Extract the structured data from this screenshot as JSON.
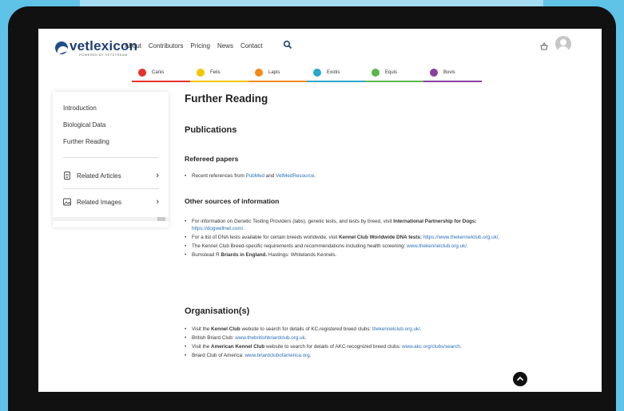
{
  "header": {
    "logo_text": "vetlexicon",
    "logo_sub": "POWERED BY VETSTREAM",
    "nav": [
      "About",
      "Contributors",
      "Pricing",
      "News",
      "Contact"
    ]
  },
  "species": [
    {
      "label": "Canis",
      "color": "#e5322d"
    },
    {
      "label": "Felis",
      "color": "#f5c400"
    },
    {
      "label": "Lapis",
      "color": "#f08a1c"
    },
    {
      "label": "Exotis",
      "color": "#2aa7c9"
    },
    {
      "label": "Equis",
      "color": "#5bb64a"
    },
    {
      "label": "Bovis",
      "color": "#8a3d9e"
    }
  ],
  "sidebar": {
    "items": [
      "Introduction",
      "Biological Data",
      "Further Reading"
    ],
    "related_articles": "Related Articles",
    "related_images": "Related Images"
  },
  "content": {
    "title": "Further Reading",
    "publications": "Publications",
    "refereed": "Refereed papers",
    "ref_text": "Recent references from ",
    "ref_link1": "PubMed",
    "ref_and": " and ",
    "ref_link2": "VetMedResource",
    "ref_end": ".",
    "other": "Other sources of information",
    "o1_a": "For information on Genetic Testing Providers (labs), genetic tests, and tests by breed, visit ",
    "o1_b": "International Partnership for Dogs:",
    "o1_c": " ",
    "o1_link": "https://dogwellnet.com/",
    "o1_end": ".",
    "o2_a": "For a list of DNA tests available for certain breeds worldwide, visit ",
    "o2_b": "Kennel Club Worldwide DNA tests:",
    "o2_c": " ",
    "o2_link": "https://www.thekennelclub.org.uk/",
    "o2_end": ".",
    "o3_a": "The Kennel Club Breed-specific requirements and recommendations including health screening: ",
    "o3_link": "www.thekennelclub.org.uk/",
    "o3_end": ".",
    "o4_a": "Bumstead R ",
    "o4_b": "Briards in England.",
    "o4_c": " Hastings: Whitelands Kennels.",
    "org": "Organisation(s)",
    "g1_a": "Visit the ",
    "g1_b": "Kennel Club",
    "g1_c": " website to search for details of KC-registered breed clubs: ",
    "g1_link": "thekennelclub.org.uk/",
    "g1_end": ".",
    "g2_a": "British Briard Club: ",
    "g2_link": "www.thebritishbriardclub.org.uk",
    "g2_end": ".",
    "g3_a": "Visit the ",
    "g3_b": "American Kennel Club",
    "g3_c": " website to search for details of AKC-recognized breed clubs: ",
    "g3_link": "www.akc.org/clubs/search",
    "g3_end": ".",
    "g4_a": "Briard Club of America: ",
    "g4_link": "www.briardclubofamerica.org",
    "g4_end": "."
  }
}
